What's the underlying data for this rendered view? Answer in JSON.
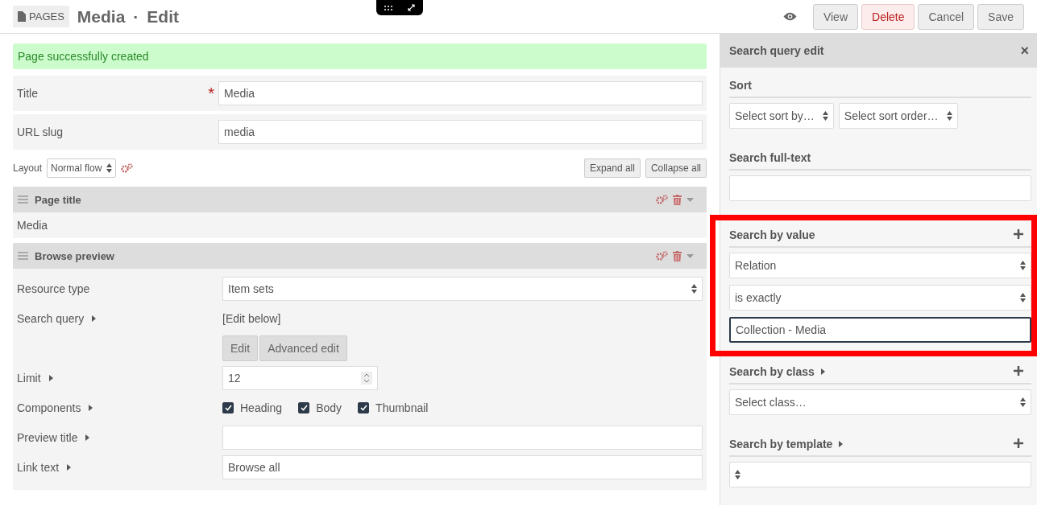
{
  "header": {
    "section": "PAGES",
    "title": "Media",
    "separator": "·",
    "subtitle": "Edit",
    "buttons": [
      {
        "label": "View",
        "kind": "default"
      },
      {
        "label": "Delete",
        "kind": "danger"
      },
      {
        "label": "Cancel",
        "kind": "default"
      },
      {
        "label": "Save",
        "kind": "default"
      }
    ]
  },
  "notice": "Page successfully created",
  "fields": [
    {
      "label": "Title",
      "value": "Media",
      "required": true,
      "required_mark": "*"
    },
    {
      "label": "URL slug",
      "value": "media"
    }
  ],
  "layout": {
    "label": "Layout",
    "value": "Normal flow"
  },
  "expand_button": "Expand all",
  "collapse_button": "Collapse all",
  "blocks": [
    {
      "title": "Page title",
      "content": "Media"
    },
    {
      "title": "Browse preview",
      "rows": [
        {
          "kind": "select",
          "label": "Resource type",
          "expandable": false,
          "value": "Item sets"
        },
        {
          "kind": "text",
          "label": "Search query",
          "expandable": true,
          "value": "[Edit below]"
        },
        {
          "kind": "buttons",
          "buttons": [
            "Edit",
            "Advanced edit"
          ]
        },
        {
          "kind": "number",
          "label": "Limit",
          "expandable": true,
          "value": "12"
        },
        {
          "kind": "checkboxes",
          "label": "Components",
          "expandable": true,
          "options": [
            {
              "label": "Heading",
              "checked": true
            },
            {
              "label": "Body",
              "checked": true
            },
            {
              "label": "Thumbnail",
              "checked": true
            }
          ]
        },
        {
          "kind": "input",
          "label": "Preview title",
          "expandable": true
        },
        {
          "kind": "input",
          "label": "Link text",
          "expandable": true,
          "value": "Browse all"
        }
      ]
    }
  ],
  "sidebar": {
    "title": "Search query edit",
    "close": "×",
    "sections": [
      {
        "title": "Sort",
        "expandable": false,
        "addable": false,
        "highlighted": false,
        "controls": [
          {
            "kind": "select",
            "value": "Select sort by…",
            "half": true
          },
          {
            "kind": "select",
            "value": "Select sort order…",
            "half": true
          }
        ]
      },
      {
        "title": "Search full-text",
        "expandable": false,
        "addable": false,
        "highlighted": false,
        "controls": [
          {
            "kind": "input"
          }
        ]
      },
      {
        "title": "Search by value",
        "expandable": false,
        "addable": true,
        "highlighted": true,
        "controls": [
          {
            "kind": "select",
            "value": "Relation"
          },
          {
            "kind": "select",
            "value": "is exactly"
          },
          {
            "kind": "input",
            "value": "Collection - Media",
            "focused": true
          }
        ]
      },
      {
        "title": "Search by class",
        "expandable": true,
        "addable": true,
        "highlighted": false,
        "controls": [
          {
            "kind": "select",
            "value": "Select class…"
          }
        ]
      },
      {
        "title": "Search by template",
        "expandable": true,
        "addable": true,
        "highlighted": false,
        "controls": [
          {
            "kind": "select"
          }
        ]
      }
    ]
  }
}
